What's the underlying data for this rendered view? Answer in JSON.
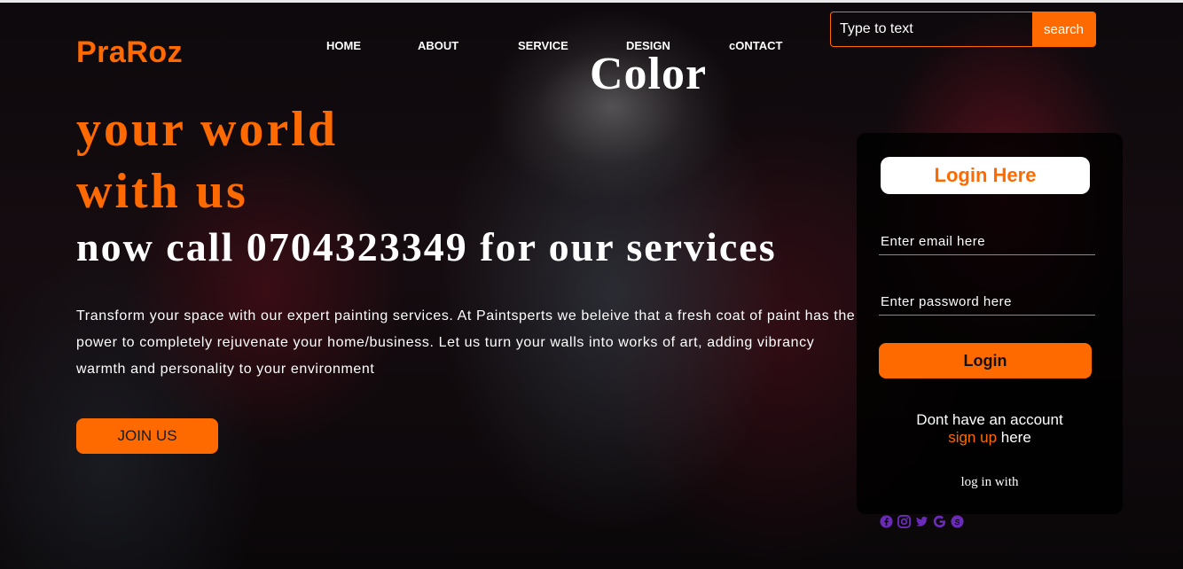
{
  "brand": {
    "logo_text": "PraRoz",
    "accent_color": "#ff6a00"
  },
  "nav": {
    "items": [
      {
        "label": "HOME"
      },
      {
        "label": "ABOUT"
      },
      {
        "label": "SERVICE"
      },
      {
        "label": "DESIGN"
      },
      {
        "label": "cONTACT"
      }
    ]
  },
  "search": {
    "placeholder": "Type to text",
    "button_label": "search"
  },
  "hero": {
    "line1": "Color",
    "line2": "your world",
    "line3": "with us",
    "line4": "now call 0704323349 for our services",
    "description": "Transform your space with our expert painting services. At Paintsperts we beleive that a fresh coat of paint has the power to completely rejuvenate your home/business. Let us turn your walls into works of art, adding vibrancy warmth and personality to your environment",
    "join_label": "JOIN US"
  },
  "login": {
    "title": "Login Here",
    "email_placeholder": "Enter email here",
    "password_placeholder": "Enter password here",
    "button_label": "Login",
    "no_account_text": "Dont have an account",
    "signup_link": "sign up",
    "signup_suffix": " here",
    "login_with": "log in with"
  },
  "social": {
    "icon_color": "#6a2bb8",
    "icons": [
      "facebook-icon",
      "instagram-icon",
      "twitter-icon",
      "google-icon",
      "skype-icon"
    ]
  }
}
